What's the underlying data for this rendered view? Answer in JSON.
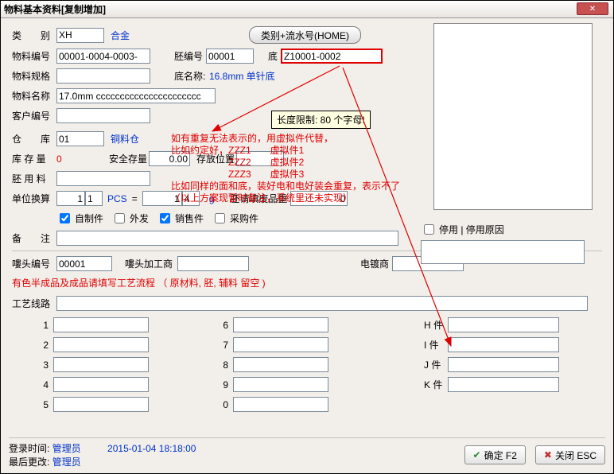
{
  "window": {
    "title": "物料基本资料[复制增加]"
  },
  "labels": {
    "category": "类　　别",
    "material_no": "物料编号",
    "blank_no": "胚编号",
    "di": "底",
    "spec": "物料规格",
    "base_name": "底名称:",
    "name": "物料名称",
    "customer": "客户编号",
    "warehouse": "仓　　库",
    "stock": "库 存 量",
    "safety": "安全存量",
    "storage": "存放位置",
    "blank_mat": "胚 用 料",
    "unit": "单位换算",
    "eq": "=",
    "blank_weight": "胚请填废品重",
    "chk_self": "自制件",
    "chk_out": "外发",
    "chk_sale": "销售件",
    "chk_buy": "采购件",
    "remark": "备　　注",
    "disable": "停用 | 停用原因",
    "lou_no": "嘍头编号",
    "lou_sup": "嘍头加工商",
    "plating": "电镀商",
    "red_line": "有色半成品及成品请填写工艺流程 （ 原材料, 胚, 辅料 留空 )",
    "route": "工艺线路",
    "hj": "H 件",
    "ij": "I 件",
    "jj": "J 件",
    "kj": "K 件",
    "login": "登录时间:",
    "last": "最后更改:",
    "user": "管理员",
    "time": "2015-01-04 18:18:00",
    "ok": "确定 F2",
    "close": "关闭 ESC"
  },
  "values": {
    "category": "XH",
    "category_link": "合金",
    "material_no": "00001-0004-0003-",
    "blank_no": "00001",
    "di": "Z10001-0002",
    "base_name": "16.8mm 单针底",
    "name": "17.0mm cccccccccccccccccccccc",
    "warehouse": "01",
    "warehouse_link": "铜料仓",
    "stock": "0",
    "safety": "0.00",
    "unit1": "1",
    "unit2": "1",
    "unit_code": "PCS",
    "unit3": "1",
    "unit4": "4",
    "unit_g": "g",
    "blank_weight": "0",
    "lou_no": "00001",
    "chk_self": true,
    "chk_out": false,
    "chk_sale": true,
    "chk_buy": false,
    "chk_disable": false
  },
  "button": {
    "home": "类别+流水号(HOME)"
  },
  "tooltip": "长度限制: 80 个字母!",
  "note": {
    "l1": "如有重复无法表示的，用虚拟件代替，",
    "l2": "比如约定好，ZZZ1　　虚拟件1",
    "l3": "　　　　　　ZZZ2　　虚拟件2",
    "l4": "　　　　　　ZZZ3　　虚拟件3",
    "l5": "比如同样的面和底，装好电和电好装会重复，表示不了",
    "l6": "（以上方案现暂时备注，系统里还未实现）"
  },
  "num_rows": {
    "1": "1",
    "2": "2",
    "3": "3",
    "4": "4",
    "5": "5",
    "6": "6",
    "7": "7",
    "8": "8",
    "9": "9",
    "0": "0"
  }
}
